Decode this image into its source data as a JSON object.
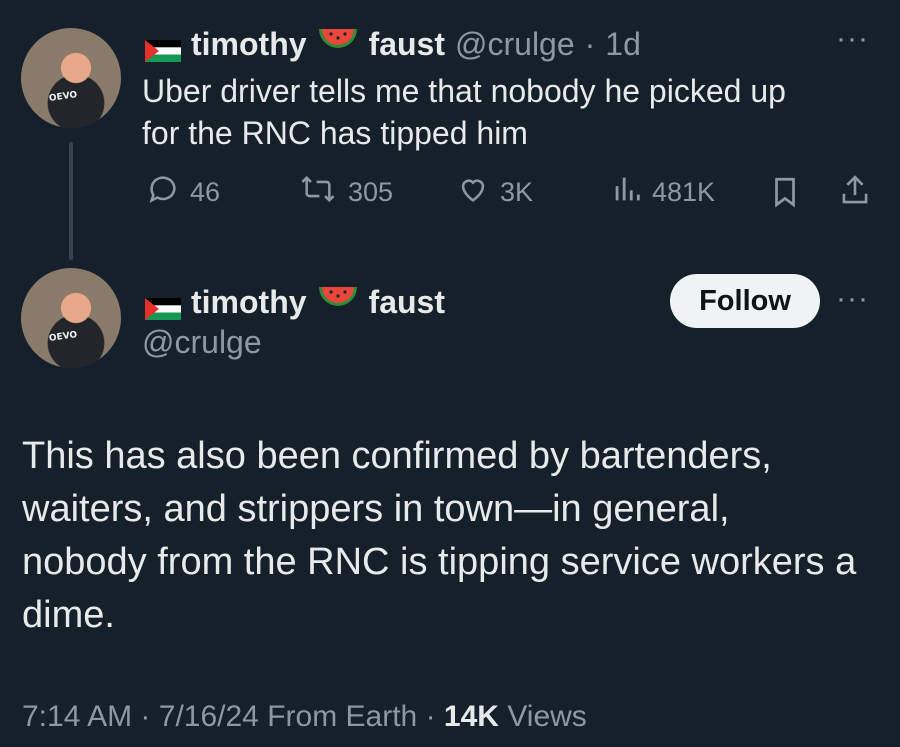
{
  "reply_tweet": {
    "display_name_first": "timothy",
    "display_name_last": "faust",
    "handle": "@crulge",
    "separator": "·",
    "time_ago": "1d",
    "text_line1": "Uber driver tells me that nobody he picked up",
    "text_line2": "for the RNC has tipped him",
    "avatar_shirt_text": "OEVO",
    "actions": {
      "replies": "46",
      "retweets": "305",
      "likes": "3K",
      "views": "481K"
    },
    "more_label": "···"
  },
  "main_tweet": {
    "display_name_first": "timothy",
    "display_name_last": "faust",
    "handle": "@crulge",
    "avatar_shirt_text": "OEVO",
    "follow_label": "Follow",
    "more_label": "···",
    "text_lines": [
      "This has also been confirmed by bartenders,",
      "waiters, and strippers in town—in general,",
      "nobody from the RNC is tipping service workers a",
      "dime."
    ],
    "meta": {
      "time": "7:14 AM",
      "sep1": "·",
      "date": "7/16/24",
      "source": "From Earth",
      "sep2": "·",
      "views_count": "14K",
      "views_label": "Views"
    }
  },
  "colors": {
    "background": "#15202b",
    "text": "#e7e9ea",
    "muted": "#8b98a5",
    "follow_bg": "#eff3f4"
  },
  "icons": [
    "palestine-flag-icon",
    "watermelon-icon",
    "reply-icon",
    "retweet-icon",
    "like-icon",
    "views-icon",
    "bookmark-icon",
    "share-icon",
    "more-icon"
  ]
}
